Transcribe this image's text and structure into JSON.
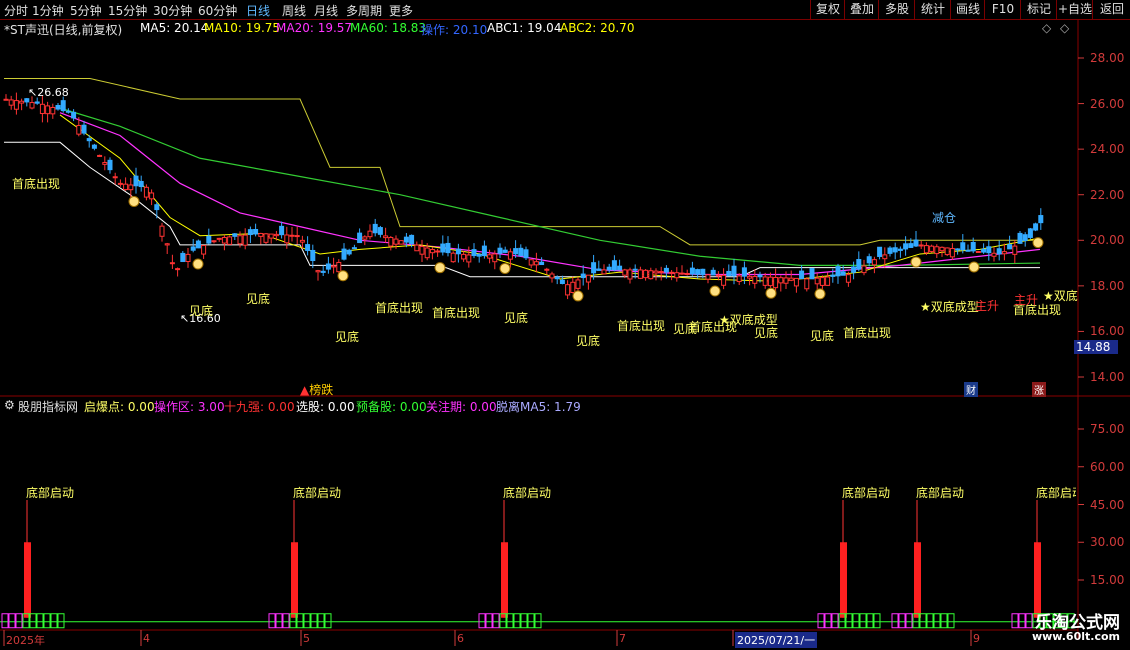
{
  "toolbar": {
    "timeframes": [
      "分时",
      "1分钟",
      "5分钟",
      "15分钟",
      "30分钟",
      "60分钟",
      "日线",
      "周线",
      "月线",
      "多周期",
      "更多"
    ],
    "active": "日线",
    "right_buttons": [
      "复权",
      "叠加",
      "多股",
      "统计",
      "画线",
      "F10",
      "标记",
      "+自选",
      "返回"
    ]
  },
  "main": {
    "title": "*ST声迅(日线,前复权)",
    "indicators": [
      {
        "label": "MA5: 20.14",
        "color": "#ffffff"
      },
      {
        "label": "MA10: 19.75",
        "color": "#ffff00"
      },
      {
        "label": "MA20: 19.57",
        "color": "#ff33ff"
      },
      {
        "label": "MA60: 18.83",
        "color": "#33ff33"
      },
      {
        "label": "操作: 20.10",
        "color": "#3366ff"
      },
      {
        "label": "ABC1: 19.04",
        "color": "#ffffff"
      },
      {
        "label": "ABC2: 20.70",
        "color": "#ffff00"
      }
    ],
    "y_ticks": [
      "28.00",
      "26.00",
      "24.00",
      "22.00",
      "20.00",
      "18.00",
      "16.00",
      "14.00"
    ],
    "y_values": [
      28,
      26,
      24,
      22,
      20,
      18,
      16,
      14
    ],
    "current_price": "14.88",
    "high_marker": "26.68",
    "low_marker": "16.60",
    "annotations_yellow": [
      {
        "text": "首底出现",
        "x": 12,
        "y": 175
      },
      {
        "text": "见底",
        "x": 189,
        "y": 302
      },
      {
        "text": "见底",
        "x": 246,
        "y": 290
      },
      {
        "text": "见底",
        "x": 335,
        "y": 328
      },
      {
        "text": "首底出现",
        "x": 375,
        "y": 299
      },
      {
        "text": "首底出现",
        "x": 432,
        "y": 304
      },
      {
        "text": "见底",
        "x": 504,
        "y": 309
      },
      {
        "text": "见底",
        "x": 576,
        "y": 332
      },
      {
        "text": "首底出现",
        "x": 617,
        "y": 317
      },
      {
        "text": "见底",
        "x": 673,
        "y": 320
      },
      {
        "text": "首底出现",
        "x": 689,
        "y": 318
      },
      {
        "text": "见底",
        "x": 754,
        "y": 324
      },
      {
        "text": "见底",
        "x": 810,
        "y": 327
      },
      {
        "text": "首底出现",
        "x": 843,
        "y": 324
      },
      {
        "text": "首底出现",
        "x": 1013,
        "y": 301
      }
    ],
    "annotations_star": [
      {
        "text": "★双底成型",
        "x": 719,
        "y": 311
      },
      {
        "text": "★双底成型",
        "x": 920,
        "y": 298
      },
      {
        "text": "★双底",
        "x": 1043,
        "y": 287
      }
    ],
    "annotations_red": [
      {
        "text": "主升",
        "x": 975,
        "y": 297
      },
      {
        "text": "主升",
        "x": 1014,
        "y": 291
      }
    ],
    "annotation_reduce": {
      "text": "减仓",
      "x": 932,
      "y": 209
    },
    "label_bottom": "榜跌",
    "badge_cai": "财",
    "badge_zhang": "涨"
  },
  "sub": {
    "title": "股朋指标网",
    "indicators": [
      {
        "label": "启爆点: 0.00",
        "color": "#ffff66"
      },
      {
        "label": "操作区: 3.00",
        "color": "#ff33ff"
      },
      {
        "label": "十九强: 0.00",
        "color": "#ff3333"
      },
      {
        "label": "选股: 0.00",
        "color": "#ffffff"
      },
      {
        "label": "预备股: 0.00",
        "color": "#33ff33"
      },
      {
        "label": "关注期: 0.00",
        "color": "#ff33ff"
      },
      {
        "label": "脱离MA5: 1.79",
        "color": "#aaaaff"
      }
    ],
    "y_ticks": [
      "75.00",
      "60.00",
      "45.00",
      "30.00",
      "15.00"
    ],
    "y_values": [
      75,
      60,
      45,
      30,
      15
    ],
    "signal_label": "底部启动",
    "signals": [
      27,
      294,
      504,
      843,
      917,
      1037
    ]
  },
  "date_axis": {
    "labels": [
      "2025年",
      "4",
      "5",
      "6",
      "7",
      "2025/07/21/一",
      "9"
    ],
    "positions": [
      6,
      143,
      303,
      457,
      619,
      735,
      973
    ]
  },
  "watermark": {
    "cn": "乐淘公式网",
    "url": "www.60lt.com"
  }
}
